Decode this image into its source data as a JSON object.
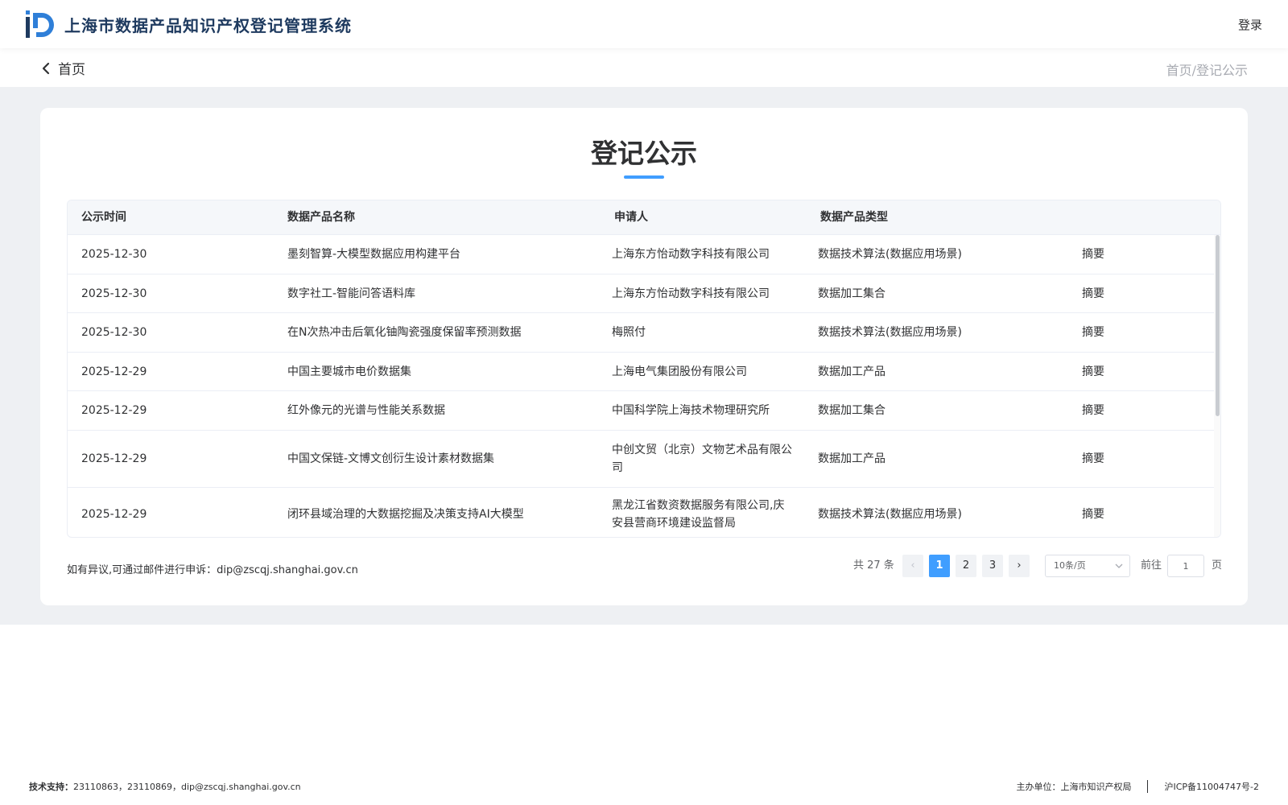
{
  "header": {
    "site_title": "上海市数据产品知识产权登记管理系统",
    "login_label": "登录"
  },
  "subbar": {
    "back_label": "首页",
    "breadcrumb": "首页/登记公示"
  },
  "main": {
    "page_title": "登记公示",
    "columns": [
      "公示时间",
      "数据产品名称",
      "申请人",
      "数据产品类型"
    ],
    "rows": [
      {
        "date": "2025-12-30",
        "name": "墨刻智算-大模型数据应用构建平台",
        "applicant": "上海东方怡动数字科技有限公司",
        "type": "数据技术算法(数据应用场景)",
        "action": "摘要"
      },
      {
        "date": "2025-12-30",
        "name": "数字社工-智能问答语料库",
        "applicant": "上海东方怡动数字科技有限公司",
        "type": "数据加工集合",
        "action": "摘要"
      },
      {
        "date": "2025-12-30",
        "name": "在N次热冲击后氧化铀陶瓷强度保留率预测数据",
        "applicant": "梅照付",
        "type": "数据技术算法(数据应用场景)",
        "action": "摘要"
      },
      {
        "date": "2025-12-29",
        "name": "中国主要城市电价数据集",
        "applicant": "上海电气集团股份有限公司",
        "type": "数据加工产品",
        "action": "摘要"
      },
      {
        "date": "2025-12-29",
        "name": "红外像元的光谱与性能关系数据",
        "applicant": "中国科学院上海技术物理研究所",
        "type": "数据加工集合",
        "action": "摘要"
      },
      {
        "date": "2025-12-29",
        "name": "中国文保链-文博文创衍生设计素材数据集",
        "applicant": "中创文贸（北京）文物艺术品有限公司",
        "type": "数据加工产品",
        "action": "摘要"
      },
      {
        "date": "2025-12-29",
        "name": "闭环县域治理的大数据挖掘及决策支持AI大模型",
        "applicant": "黑龙江省数资数据服务有限公司,庆安县营商环境建设监督局",
        "type": "数据技术算法(数据应用场景)",
        "action": "摘要"
      }
    ],
    "appeal_text": "如有异议,可通过邮件进行申诉：",
    "appeal_email": "dip@zscqj.shanghai.gov.cn"
  },
  "pagination": {
    "total_text": "共 27 条",
    "prev": "‹",
    "next": "›",
    "pages": [
      "1",
      "2",
      "3"
    ],
    "active_page": "1",
    "page_size": "10条/页",
    "goto_label": "前往",
    "goto_value": "1",
    "goto_suffix": "页"
  },
  "footer": {
    "tech_label": "技术支持：",
    "tech_contacts": "23110863，23110869，dip@zscqj.shanghai.gov.cn",
    "host_label": "主办单位：",
    "host_name": "上海市知识产权局",
    "icp": "沪ICP备11004747号-2"
  },
  "colors": {
    "accent": "#409eff",
    "title_navy": "#1e3a5f",
    "band_grey": "#eef0f3"
  }
}
